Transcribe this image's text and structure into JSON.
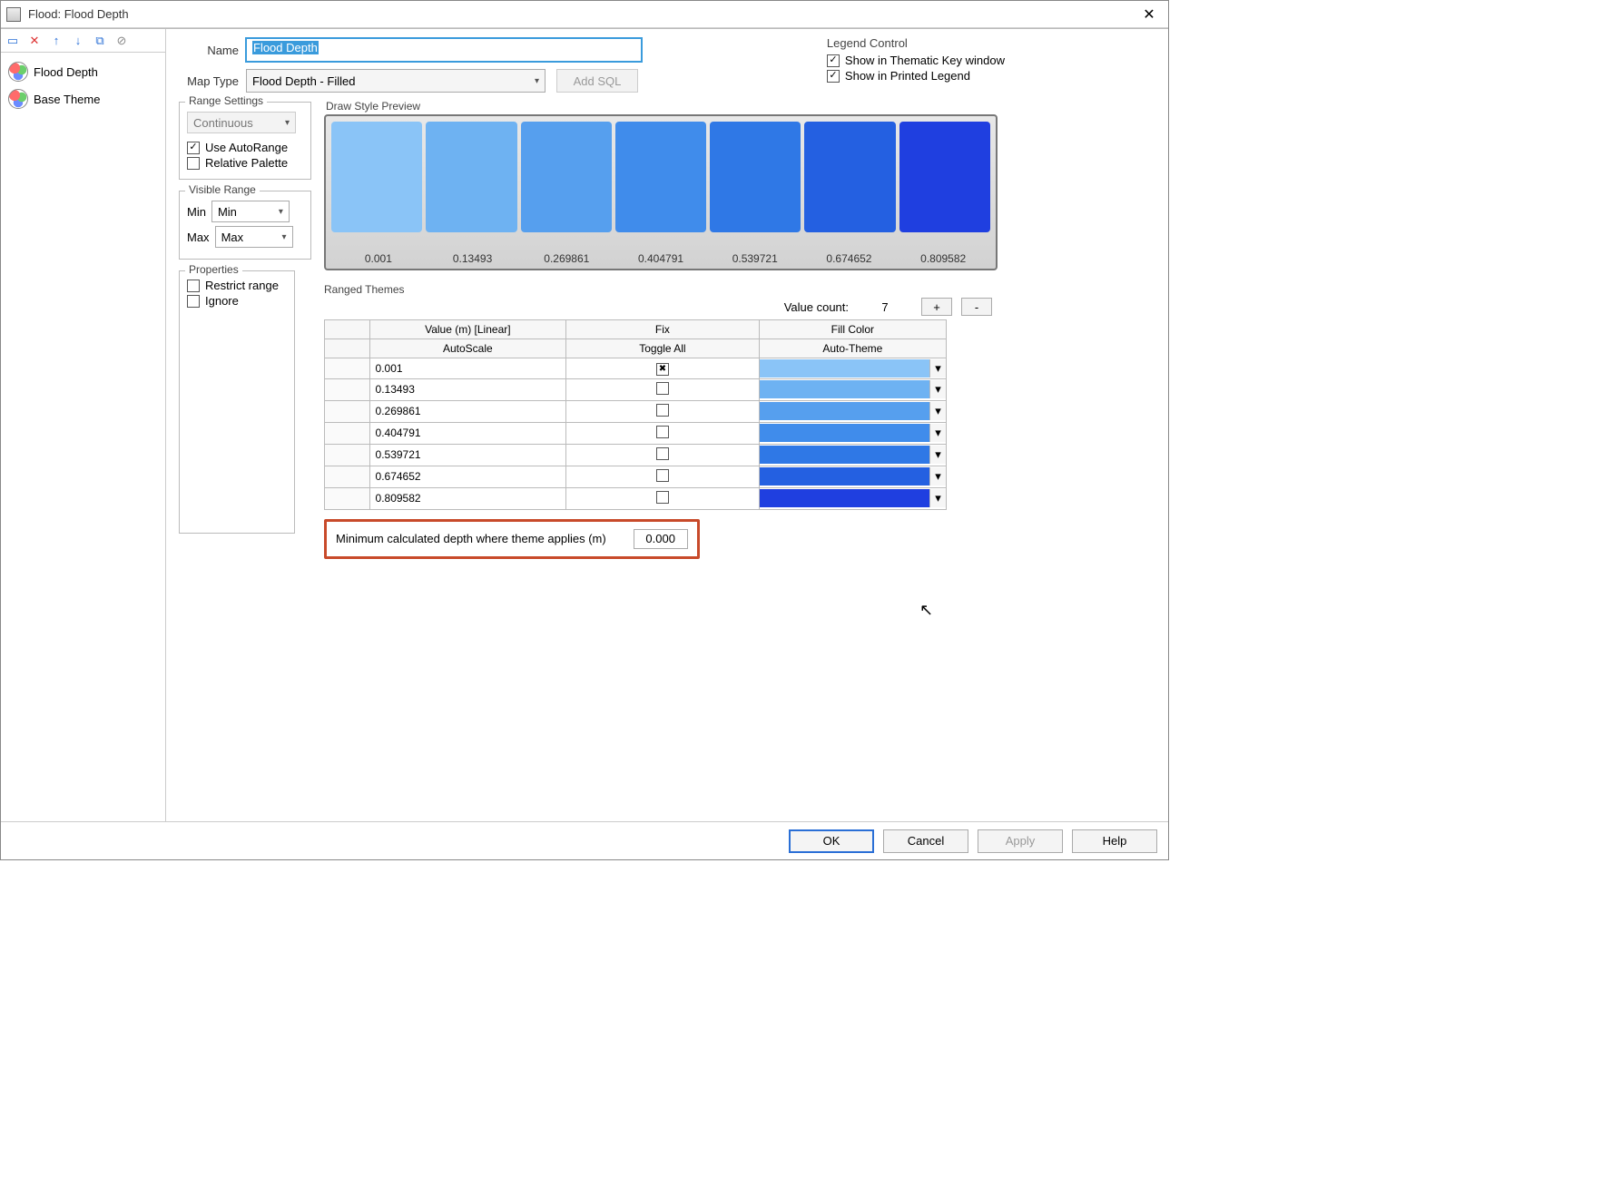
{
  "window": {
    "title": "Flood: Flood Depth"
  },
  "toolbar_icons": [
    "layers-icon",
    "delete-icon",
    "move-up-icon",
    "move-down-icon",
    "copy-icon",
    "reset-icon"
  ],
  "tree": [
    {
      "label": "Flood Depth",
      "selected": false
    },
    {
      "label": "Base Theme",
      "selected": false
    }
  ],
  "name": {
    "label": "Name",
    "value": "Flood Depth"
  },
  "mapType": {
    "label": "Map Type",
    "value": "Flood Depth - Filled",
    "addSql": "Add SQL"
  },
  "legend": {
    "title": "Legend Control",
    "showThematic": {
      "label": "Show in Thematic Key window",
      "checked": true
    },
    "showPrinted": {
      "label": "Show in Printed Legend",
      "checked": true
    }
  },
  "rangeSettings": {
    "title": "Range Settings",
    "mode": "Continuous",
    "autoRange": {
      "label": "Use AutoRange",
      "checked": true
    },
    "relative": {
      "label": "Relative Palette",
      "checked": false
    }
  },
  "visibleRange": {
    "title": "Visible Range",
    "minLabel": "Min",
    "minValue": "Min",
    "maxLabel": "Max",
    "maxValue": "Max"
  },
  "properties": {
    "title": "Properties",
    "restrict": {
      "label": "Restrict range",
      "checked": false
    },
    "ignore": {
      "label": "Ignore",
      "checked": false
    }
  },
  "preview": {
    "title": "Draw Style Preview",
    "colors": [
      "#8ac4f7",
      "#6eb2f2",
      "#569fee",
      "#408ceb",
      "#2f78e6",
      "#2460e1",
      "#1f3fe0"
    ],
    "ticks": [
      "0.001",
      "0.13493",
      "0.269861",
      "0.404791",
      "0.539721",
      "0.674652",
      "0.809582"
    ]
  },
  "ranged": {
    "title": "Ranged Themes",
    "valueCountLabel": "Value count:",
    "valueCount": "7",
    "plus": "+",
    "minus": "-",
    "headers": {
      "value": "Value (m) [Linear]",
      "fix": "Fix",
      "fill": "Fill Color"
    },
    "sub": {
      "auto": "AutoScale",
      "toggle": "Toggle All",
      "theme": "Auto-Theme"
    },
    "rows": [
      {
        "value": "0.001",
        "fixed": true,
        "color": "#8ac4f7"
      },
      {
        "value": "0.13493",
        "fixed": false,
        "color": "#6eb2f2"
      },
      {
        "value": "0.269861",
        "fixed": false,
        "color": "#569fee"
      },
      {
        "value": "0.404791",
        "fixed": false,
        "color": "#408ceb"
      },
      {
        "value": "0.539721",
        "fixed": false,
        "color": "#2f78e6"
      },
      {
        "value": "0.674652",
        "fixed": false,
        "color": "#2460e1"
      },
      {
        "value": "0.809582",
        "fixed": false,
        "color": "#1f3fe0"
      }
    ]
  },
  "minDepth": {
    "label": "Minimum calculated depth where theme applies (m)",
    "value": "0.000"
  },
  "footer": {
    "ok": "OK",
    "cancel": "Cancel",
    "apply": "Apply",
    "help": "Help"
  }
}
